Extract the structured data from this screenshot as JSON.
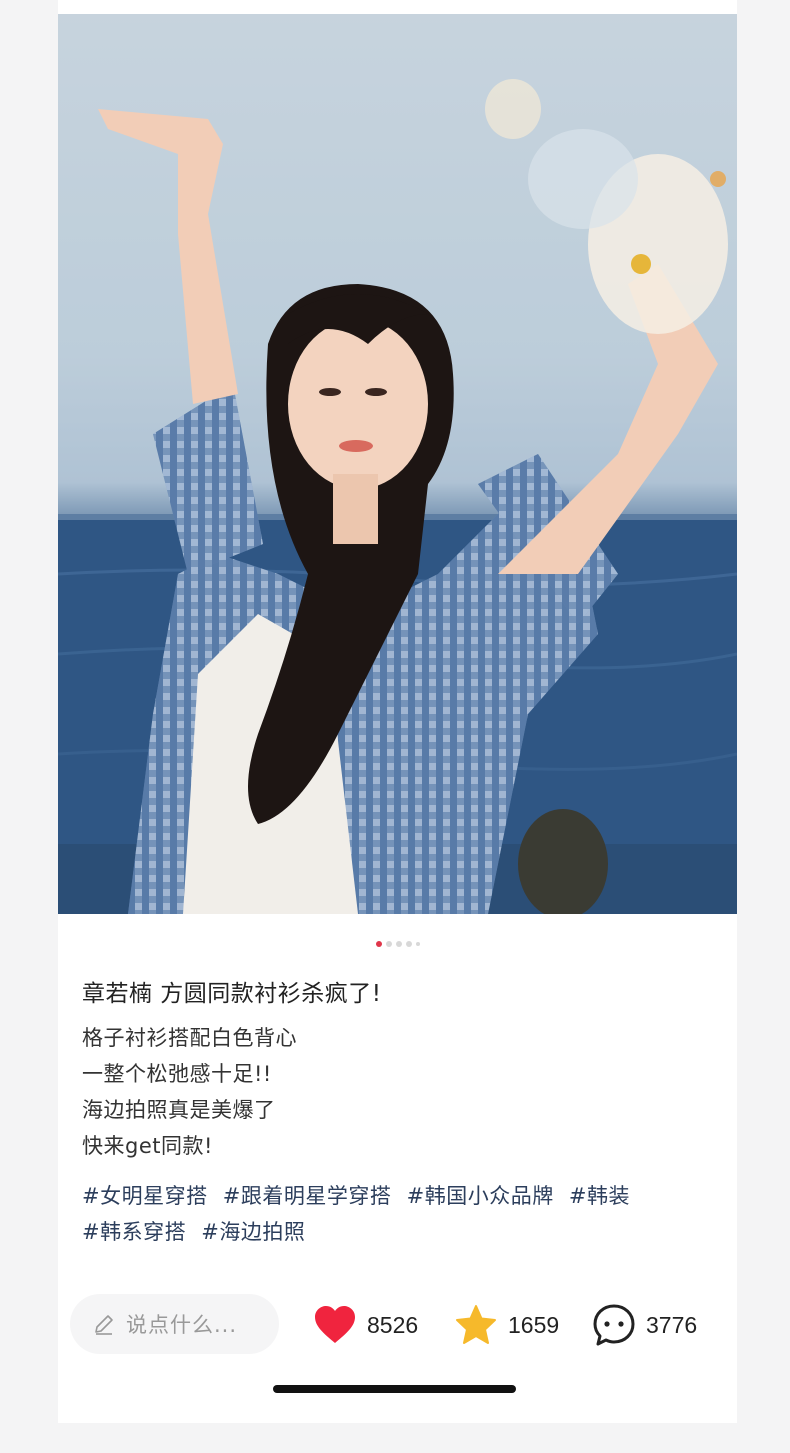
{
  "post": {
    "title": "章若楠 方圆同款衬衫杀疯了!",
    "description": [
      "格子衬衫搭配白色背心",
      "一整个松弛感十足!!",
      "海边拍照真是美爆了",
      "快来get同款!"
    ],
    "tags": [
      "#女明星穿搭",
      "#跟着明星学穿搭",
      "#韩国小众品牌",
      "#韩装",
      "#韩系穿搭",
      "#海边拍照"
    ],
    "image_count": 5,
    "active_image_index": 0
  },
  "actions": {
    "comment_placeholder": "说点什么...",
    "likes": "8526",
    "favorites": "1659",
    "comments": "3776"
  },
  "colors": {
    "accent": "#e0364a",
    "like": "#f0243e",
    "favorite": "#f6b92b"
  },
  "icons": [
    "pencil-icon",
    "heart-icon",
    "star-icon",
    "comment-icon"
  ]
}
